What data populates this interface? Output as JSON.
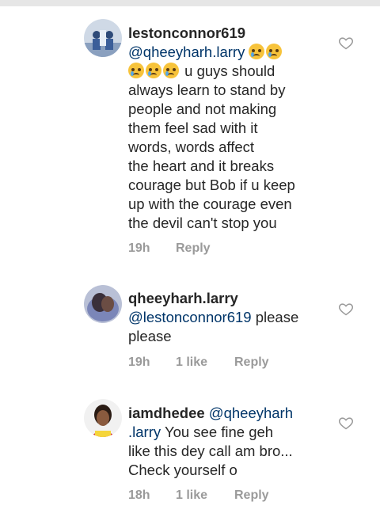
{
  "comments": [
    {
      "username": "lestonconnor619",
      "mention": "@qheeyharh.larry",
      "line1_rest": "u guys should",
      "lines": [
        "always learn to stand by",
        "people and not making",
        "them feel sad with it",
        "words, words affect",
        "the heart and it breaks",
        "courage but Bob if u keep",
        "up with the courage even",
        "the devil can't stop you"
      ],
      "time": "19h",
      "likes": "",
      "reply": "Reply"
    },
    {
      "username": "qheeyharh.larry",
      "mention": "@lestonconnor619",
      "after_mention": "please",
      "line2": "please",
      "time": "19h",
      "likes": "1 like",
      "reply": "Reply"
    },
    {
      "username": "iamdhedee",
      "mention_part1": "@qheeyharh",
      "mention_part2": ".larry",
      "line2_rest": "You see fine geh",
      "line3": "like this dey call am bro...",
      "line4": "Check yourself o",
      "time": "18h",
      "likes": "1 like",
      "reply": "Reply"
    }
  ],
  "icons": [
    "heart-icon"
  ],
  "colors": {
    "mention": "#003569",
    "meta": "#9a9a9a",
    "text": "#262626"
  }
}
